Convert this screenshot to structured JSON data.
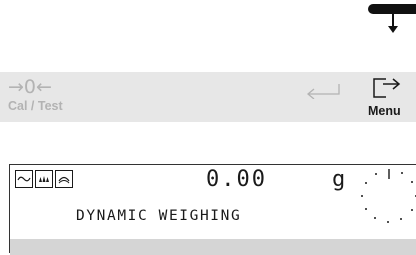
{
  "keys": {
    "zero": {
      "glyph": "→0←",
      "label": "Cal / Test"
    },
    "enter": {
      "icon": "enter-return-icon"
    },
    "menu": {
      "icon": "menu-exit-arrow-icon",
      "label": "Menu"
    }
  },
  "finger_pointer": {
    "icon": "finger-press-indicator-icon"
  },
  "display": {
    "status_icons": [
      "stability-wave-icon",
      "dosing-drops-icon",
      "round-filter-icon"
    ],
    "weight_value": "0.00",
    "unit": "g",
    "mode_label": "DYNAMIC WEIGHING"
  },
  "colors": {
    "keybar_bg": "#e7e7e7",
    "inactive_text": "#b3b3b3",
    "active_text": "#1a1a1a",
    "display_border": "#333333",
    "display_footer": "#d5d5d5"
  }
}
